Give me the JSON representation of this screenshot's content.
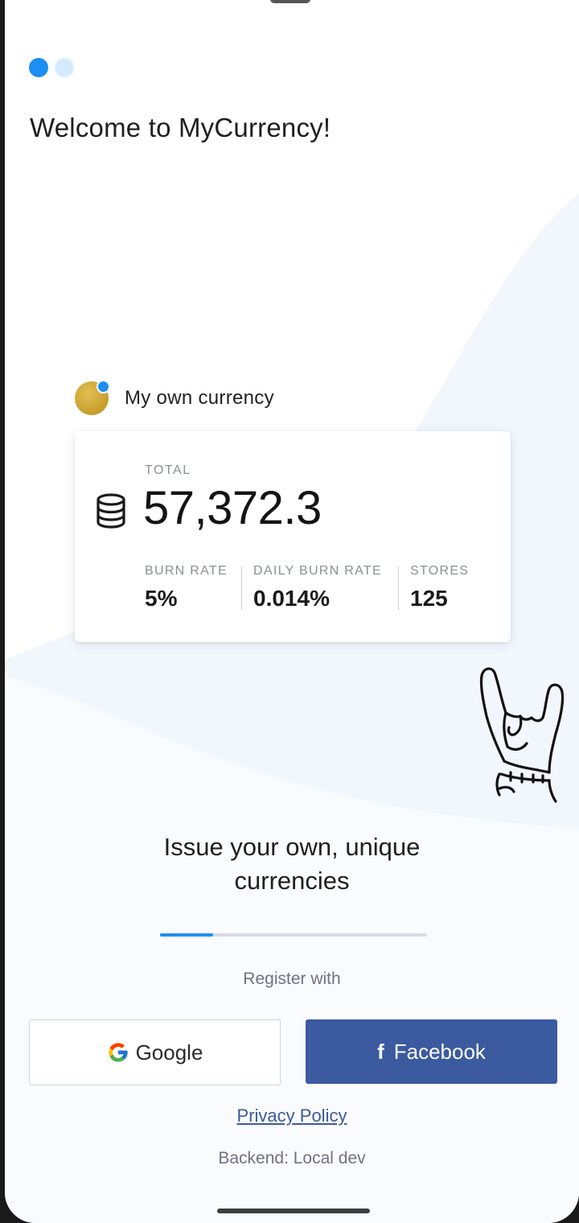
{
  "app": {
    "title": "Welcome to MyCurrency!"
  },
  "pager": {
    "pages": 2,
    "active_index": 0
  },
  "currency": {
    "name": "My own currency",
    "icon": "coin-icon",
    "total_label": "TOTAL",
    "total_value": "57,372.3",
    "stats": [
      {
        "label": "BURN RATE",
        "value": "5%"
      },
      {
        "label": "DAILY BURN RATE",
        "value": "0.014%"
      },
      {
        "label": "STORES",
        "value": "125"
      }
    ]
  },
  "onboarding": {
    "subtitle_line1": "Issue your own, unique",
    "subtitle_line2": "currencies",
    "progress_fraction": 0.2
  },
  "register": {
    "label": "Register with",
    "google_label": "Google",
    "facebook_label": "Facebook"
  },
  "footer": {
    "privacy_label": "Privacy Policy",
    "backend_label": "Backend: Local dev"
  },
  "colors": {
    "accent": "#1d8ff2",
    "facebook": "#3b5aa0",
    "coin": "#c79d2a"
  }
}
